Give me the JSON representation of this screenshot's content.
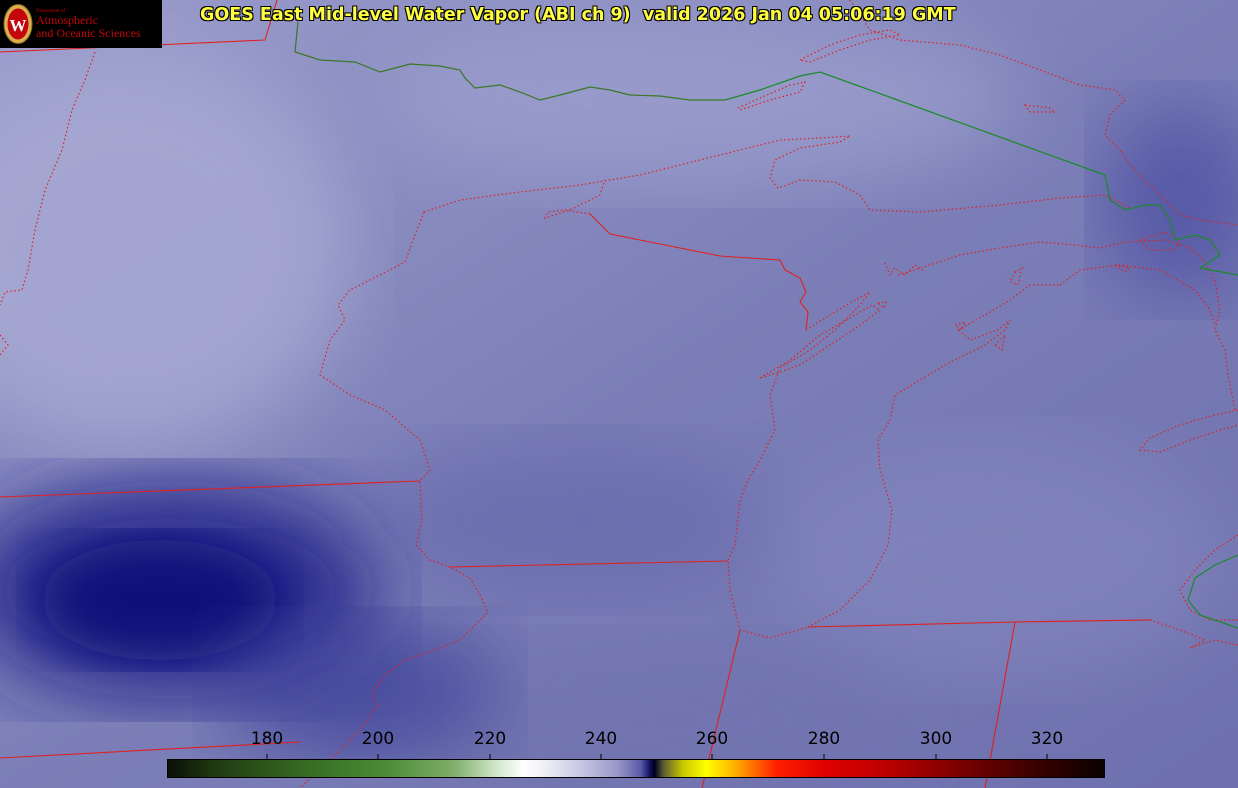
{
  "title": "GOES East Mid-level Water Vapor (ABI ch 9)  valid 2026 Jan 04 05:06:19 GMT",
  "logo": {
    "department": "Department of",
    "line1": "Atmospheric",
    "line2": "and Oceanic Sciences",
    "seal_letter": "W"
  },
  "colorbar": {
    "unit": "",
    "ticks": [
      "180",
      "200",
      "220",
      "240",
      "260",
      "280",
      "300",
      "320"
    ]
  },
  "colors": {
    "title": "#ffff40",
    "state_borders": "#e02020",
    "international_border": "#1a8a2a",
    "logo_text": "#c5050c"
  }
}
